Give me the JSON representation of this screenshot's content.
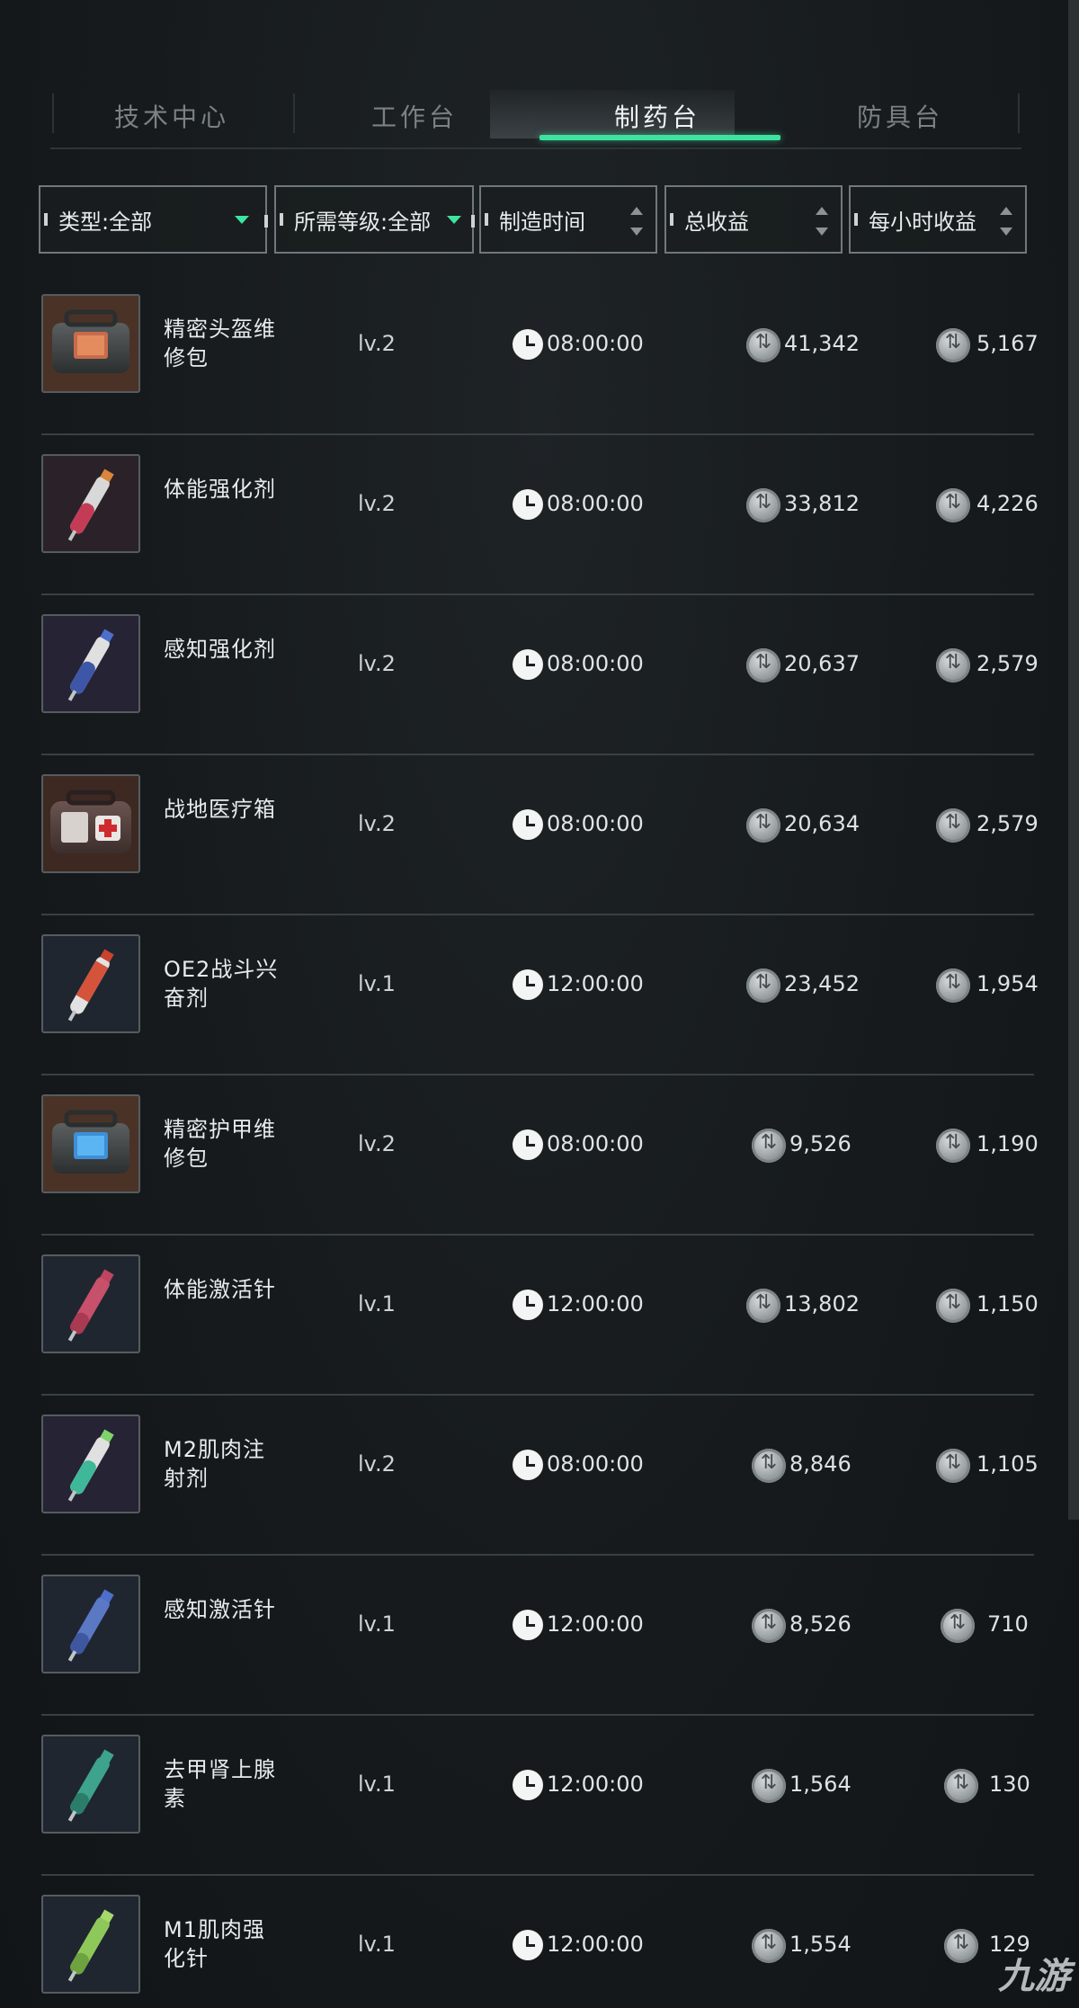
{
  "tabs": [
    {
      "label": "技术中心"
    },
    {
      "label": "工作台"
    },
    {
      "label": "制药台"
    },
    {
      "label": "防具台"
    }
  ],
  "filters": {
    "type": "类型:全部",
    "level": "所需等级:全部",
    "time": "制造时间",
    "total": "总收益",
    "hourly": "每小时收益"
  },
  "rows": [
    {
      "name": "精密头盔维修包",
      "icon": "repair-kit-icon",
      "level": "lv.2",
      "time": "08:00:00",
      "total": "41,342",
      "hourly": "5,167"
    },
    {
      "name": "体能强化剂",
      "icon": "syringe-icon",
      "level": "lv.2",
      "time": "08:00:00",
      "total": "33,812",
      "hourly": "4,226"
    },
    {
      "name": "感知强化剂",
      "icon": "syringe-icon",
      "level": "lv.2",
      "time": "08:00:00",
      "total": "20,637",
      "hourly": "2,579"
    },
    {
      "name": "战地医疗箱",
      "icon": "medkit-icon",
      "level": "lv.2",
      "time": "08:00:00",
      "total": "20,634",
      "hourly": "2,579"
    },
    {
      "name": "OE2战斗兴奋剂",
      "icon": "syringe-icon",
      "level": "lv.1",
      "time": "12:00:00",
      "total": "23,452",
      "hourly": "1,954"
    },
    {
      "name": "精密护甲维修包",
      "icon": "repair-kit-icon",
      "level": "lv.2",
      "time": "08:00:00",
      "total": "9,526",
      "hourly": "1,190"
    },
    {
      "name": "体能激活针",
      "icon": "syringe-icon",
      "level": "lv.1",
      "time": "12:00:00",
      "total": "13,802",
      "hourly": "1,150"
    },
    {
      "name": "M2肌肉注射剂",
      "icon": "syringe-icon",
      "level": "lv.2",
      "time": "08:00:00",
      "total": "8,846",
      "hourly": "1,105"
    },
    {
      "name": "感知激活针",
      "icon": "syringe-icon",
      "level": "lv.1",
      "time": "12:00:00",
      "total": "8,526",
      "hourly": "710"
    },
    {
      "name": "去甲肾上腺素",
      "icon": "syringe-icon",
      "level": "lv.1",
      "time": "12:00:00",
      "total": "1,564",
      "hourly": "130"
    },
    {
      "name": "M1肌肉强化针",
      "icon": "syringe-icon",
      "level": "lv.1",
      "time": "12:00:00",
      "total": "1,554",
      "hourly": "129"
    }
  ],
  "watermark": "九游",
  "colors": {
    "accent": "#3fe3a1",
    "background": "#161a1c",
    "divider": "#384043"
  }
}
